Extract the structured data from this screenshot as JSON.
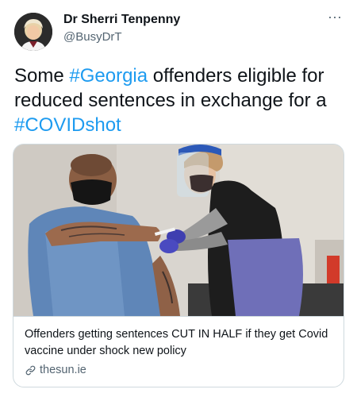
{
  "author": {
    "display_name": "Dr Sherri Tenpenny",
    "handle": "@BusyDrT",
    "avatar_icon": "profile-photo"
  },
  "tweet": {
    "text_part1": "Some ",
    "hashtag1": "#Georgia",
    "text_part2": " offenders eligible for reduced sentences in exchange for a ",
    "hashtag2": "#COVIDshot"
  },
  "more_icon": "···",
  "card": {
    "image_icon": "vaccination-photo",
    "title": "Offenders getting sentences CUT IN HALF if they get Covid vaccine under shock new policy",
    "domain": "thesun.ie",
    "domain_icon": "link-icon"
  },
  "colors": {
    "hashtag": "#1d9bf0",
    "secondary_text": "#536471",
    "border": "#cfd9de"
  }
}
